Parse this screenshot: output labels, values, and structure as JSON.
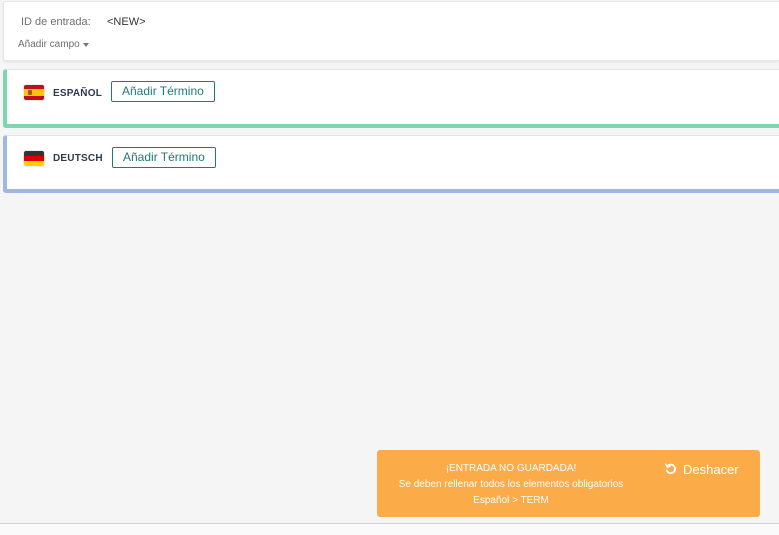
{
  "entry": {
    "id_label": "ID de entrada:",
    "id_value": "<NEW>",
    "add_field_label": "Añadir campo"
  },
  "languages": [
    {
      "name": "ESPAÑOL",
      "flag": "spain-flag-icon",
      "accent": "#7fd5ad",
      "add_term_label": "Añadir Término"
    },
    {
      "name": "DEUTSCH",
      "flag": "germany-flag-icon",
      "accent": "#a0b8e0",
      "add_term_label": "Añadir Término"
    }
  ],
  "toast": {
    "title": "¡ENTRADA NO GUARDADA!",
    "message": "Se deben rellenar todos los elementos obligatorios",
    "detail": "Español > TERM",
    "undo_label": "Deshacer",
    "undo_icon": "undo-icon",
    "color": "#fbab47"
  }
}
